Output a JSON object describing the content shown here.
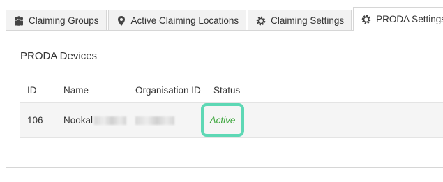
{
  "tabs": [
    {
      "label": "Claiming Groups",
      "icon": "users-icon",
      "active": false
    },
    {
      "label": "Active Claiming Locations",
      "icon": "map-marker-icon",
      "active": false
    },
    {
      "label": "Claiming Settings",
      "icon": "gear-icon",
      "active": false
    },
    {
      "label": "PRODA Settings",
      "icon": "gear-icon",
      "active": true
    }
  ],
  "section": {
    "title": "PRODA Devices"
  },
  "table": {
    "headers": {
      "id": "ID",
      "name": "Name",
      "org": "Organisation ID",
      "status": "Status"
    },
    "rows": [
      {
        "id": "106",
        "name": "Nookal",
        "status": "Active"
      }
    ]
  },
  "colors": {
    "active_status": "#3aa53a",
    "highlight_border": "#5ed8b5",
    "row_bg": "#f5f5f5"
  }
}
